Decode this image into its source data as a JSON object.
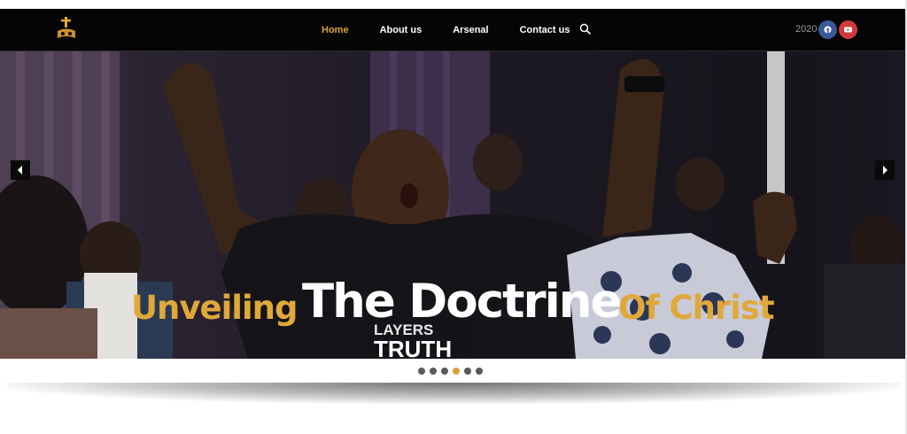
{
  "header": {
    "logo_icon": "cross-church-logo-icon",
    "nav": [
      {
        "label": "Home",
        "active": true
      },
      {
        "label": "About us",
        "active": false
      },
      {
        "label": "Arsenal",
        "active": false
      },
      {
        "label": "Contact us",
        "active": false
      }
    ],
    "search_icon": "search-icon",
    "year": "2020",
    "social": [
      {
        "name": "facebook-icon",
        "color": "#3b5998"
      },
      {
        "name": "youtube-icon",
        "color": "#d23a3a"
      }
    ]
  },
  "hero": {
    "headline_part1": "Unveiling",
    "headline_part2": "The Doctrine",
    "headline_part3": "Of Christ",
    "shirt_text_line1": "LAYERS",
    "shirt_text_line2": "TRUTH",
    "prev_icon": "chevron-left-icon",
    "next_icon": "chevron-right-icon",
    "slide_count": 6,
    "active_slide": 4,
    "accent_color": "#e0a83b"
  }
}
